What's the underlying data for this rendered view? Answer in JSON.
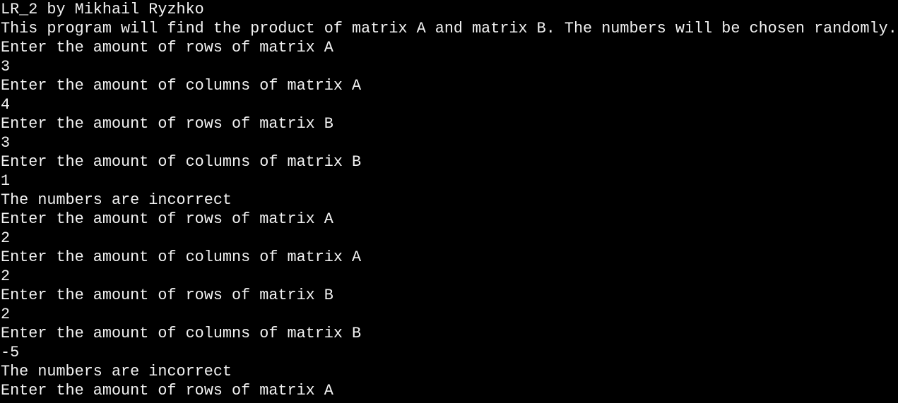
{
  "console": {
    "text_color": "#f2f2f2",
    "background_color": "#000000",
    "lines": [
      "LR_2 by Mikhail Ryzhko",
      "This program will find the product of matrix A and matrix B. The numbers will be chosen randomly.",
      "Enter the amount of rows of matrix A",
      "3",
      "Enter the amount of columns of matrix A",
      "4",
      "Enter the amount of rows of matrix B",
      "3",
      "Enter the amount of columns of matrix B",
      "1",
      "The numbers are incorrect",
      "Enter the amount of rows of matrix A",
      "2",
      "Enter the amount of columns of matrix A",
      "2",
      "Enter the amount of rows of matrix B",
      "2",
      "Enter the amount of columns of matrix B",
      "-5",
      "The numbers are incorrect",
      "Enter the amount of rows of matrix A"
    ]
  }
}
